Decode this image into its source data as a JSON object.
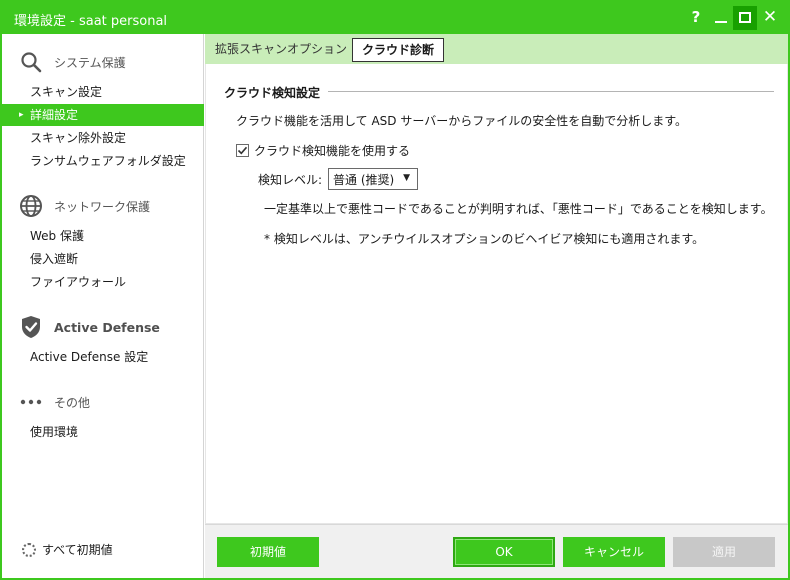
{
  "window": {
    "title": "環境設定 - saat personal"
  },
  "titlebar": {
    "help": "?",
    "close": "✕"
  },
  "sidebar": {
    "sections": [
      {
        "title": "システム保護",
        "items": [
          "スキャン設定",
          "詳細設定",
          "スキャン除外設定",
          "ランサムウェアフォルダ設定"
        ]
      },
      {
        "title": "ネットワーク保護",
        "items": [
          "Web 保護",
          "侵入遮断",
          "ファイアウォール"
        ]
      },
      {
        "title": "Active Defense",
        "items": [
          "Active Defense 設定"
        ]
      },
      {
        "title": "その他",
        "items": [
          "使用環境"
        ]
      }
    ],
    "active_item": "詳細設定",
    "reset_all": "すべて初期値"
  },
  "tabs": [
    {
      "label": "拡張スキャンオプション"
    },
    {
      "label": "クラウド診断"
    }
  ],
  "cloud": {
    "section_title": "クラウド検知設定",
    "description": "クラウド機能を活用して ASD サーバーからファイルの安全性を自動で分析します。",
    "checkbox_label": "クラウド検知機能を使用する",
    "checkbox_checked": true,
    "level_label": "検知レベル:",
    "level_value": "普通 (推奨)",
    "note1": "一定基準以上で悪性コードであることが判明すれば、「悪性コード」であることを検知します。",
    "note2": "* 検知レベルは、アンチウイルスオプションのビヘイビア検知にも適用されます。"
  },
  "footer": {
    "defaults": "初期値",
    "ok": "OK",
    "cancel": "キャンセル",
    "apply": "適用"
  },
  "colors": {
    "accent": "#3ec81e",
    "tabbar": "#c9edb9",
    "disabled": "#c8c8c8"
  }
}
